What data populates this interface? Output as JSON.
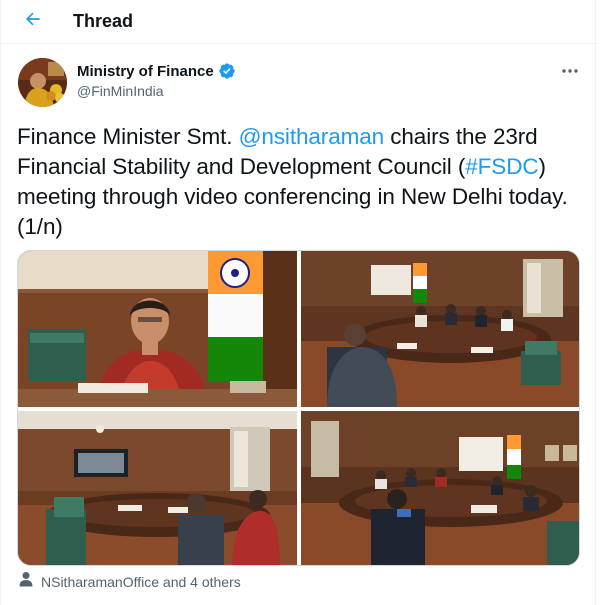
{
  "header": {
    "back_icon": "arrow-left-icon",
    "title": "Thread"
  },
  "author": {
    "name": "Ministry of Finance",
    "handle": "@FinMinIndia",
    "verified_icon": "verified-badge-icon",
    "more_icon": "more-horizontal-icon"
  },
  "tweet": {
    "text_pre": "Finance Minister Smt. ",
    "mention": "@nsitharaman",
    "text_mid": " chairs the 23rd Financial Stability and Development Council (",
    "hashtag": "#FSDC",
    "text_post": ") meeting through video conferencing in New Delhi today. (1/n)"
  },
  "media": {
    "photos": [
      {
        "subject": "finance-minister-at-desk"
      },
      {
        "subject": "conference-room-meeting"
      },
      {
        "subject": "conference-room-with-video-screen"
      },
      {
        "subject": "council-meeting-wide-view"
      }
    ]
  },
  "footer": {
    "people_icon": "person-icon",
    "liked_by": "NSitharamanOffice and 4 others"
  },
  "colors": {
    "accent": "#1d9bf0",
    "text": "#0f1419",
    "muted": "#536471",
    "border": "#eff3f4"
  }
}
